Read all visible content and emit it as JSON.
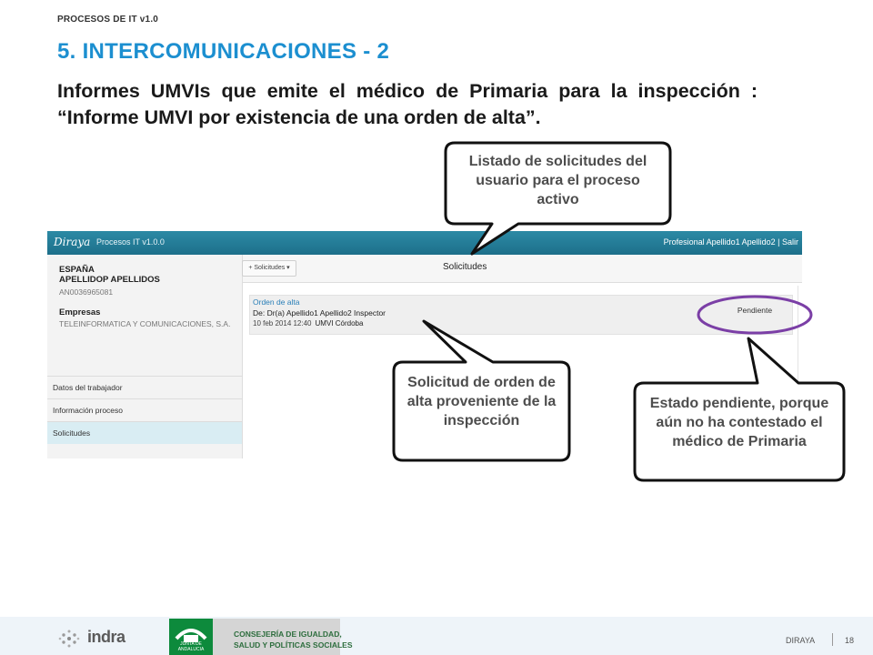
{
  "header": {
    "small_title": "PROCESOS DE IT v1.0",
    "title": "5. INTERCOMUNICACIONES - 2",
    "body": "Informes UMVIs que emite el médico de Primaria para la inspección : “Informe UMVI por existencia de una orden de alta”."
  },
  "app": {
    "logo": "Diraya",
    "name": "Procesos IT v1.0.0",
    "user": "Profesional Apellido1 Apellido2 | Salir",
    "patient": {
      "country": "ESPAÑA",
      "name": "APELLIDOP APELLIDOS",
      "id": "AN0036965081",
      "company_label": "Empresas",
      "company": "TELEINFORMATICA Y COMUNICACIONES, S.A."
    },
    "nav": [
      {
        "label": "Datos del trabajador"
      },
      {
        "label": "Información proceso"
      },
      {
        "label": "Solicitudes"
      }
    ],
    "main": {
      "dropdown": "+ Solicitudes ▾",
      "title": "Solicitudes",
      "request": {
        "type": "Orden de alta",
        "from": "De: Dr(a) Apellido1 Apellido2 Inspector",
        "date": "10 feb 2014 12:40",
        "org": "UMVI Córdoba",
        "status": "Pendiente"
      }
    }
  },
  "callouts": {
    "top": "Listado de solicitudes del usuario para el proceso activo",
    "middle": "Solicitud de orden de alta proveniente de la inspección",
    "right": "Estado pendiente, porque aún no ha contestado el médico de Primaria"
  },
  "footer": {
    "brand": "indra",
    "logo_text": "JUNTA DE ANDALUCIA",
    "consejeria_line1": "CONSEJERÍA DE IGUALDAD,",
    "consejeria_line2": "SALUD Y POLÍTICAS SOCIALES",
    "label": "DIRAYA",
    "page": "18"
  },
  "colors": {
    "title": "#1c8fd0",
    "app_bar": "#1d6f8a",
    "callout_border": "#111111",
    "highlight_ellipse": "#7b3fa6"
  }
}
